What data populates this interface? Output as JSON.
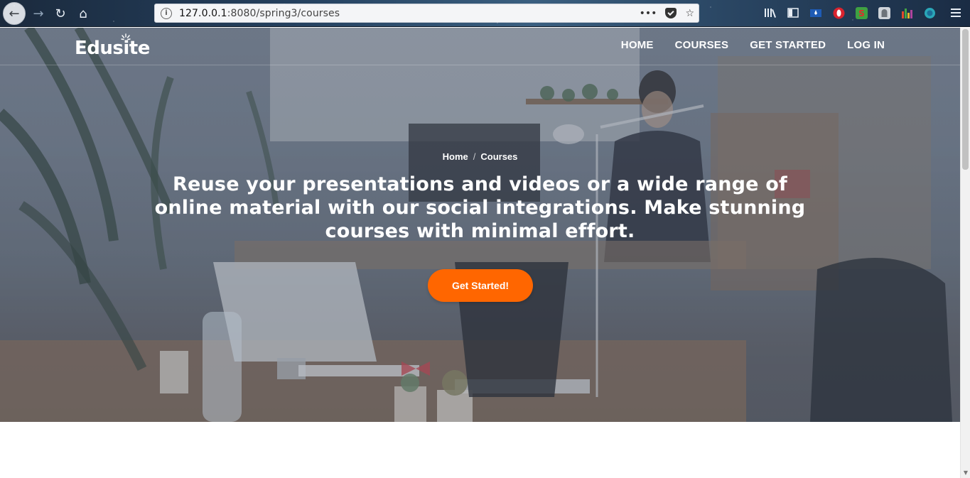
{
  "browser": {
    "url_host": "127.0.0.1",
    "url_rest": ":8080/spring3/courses",
    "page_actions_label": "•••",
    "icons": [
      "back-arrow-icon",
      "forward-arrow-icon",
      "reload-icon",
      "home-icon",
      "info-icon",
      "pocket-icon",
      "star-icon",
      "library-icon",
      "sidebar-icon",
      "extension-icons",
      "menu-icon"
    ]
  },
  "site": {
    "logo_text": "Edusite",
    "nav": {
      "home": "HOME",
      "courses": "COURSES",
      "get_started": "GET STARTED",
      "log_in": "LOG IN"
    }
  },
  "hero": {
    "breadcrumb_home": "Home",
    "breadcrumb_sep": "/",
    "breadcrumb_current": "Courses",
    "headline": "Reuse your presentations and videos or a wide range of online material with our social integrations. Make stunning courses with minimal effort.",
    "cta_label": "Get Started!"
  },
  "colors": {
    "accent": "#ff6600",
    "hero_overlay": "#4a586e"
  }
}
